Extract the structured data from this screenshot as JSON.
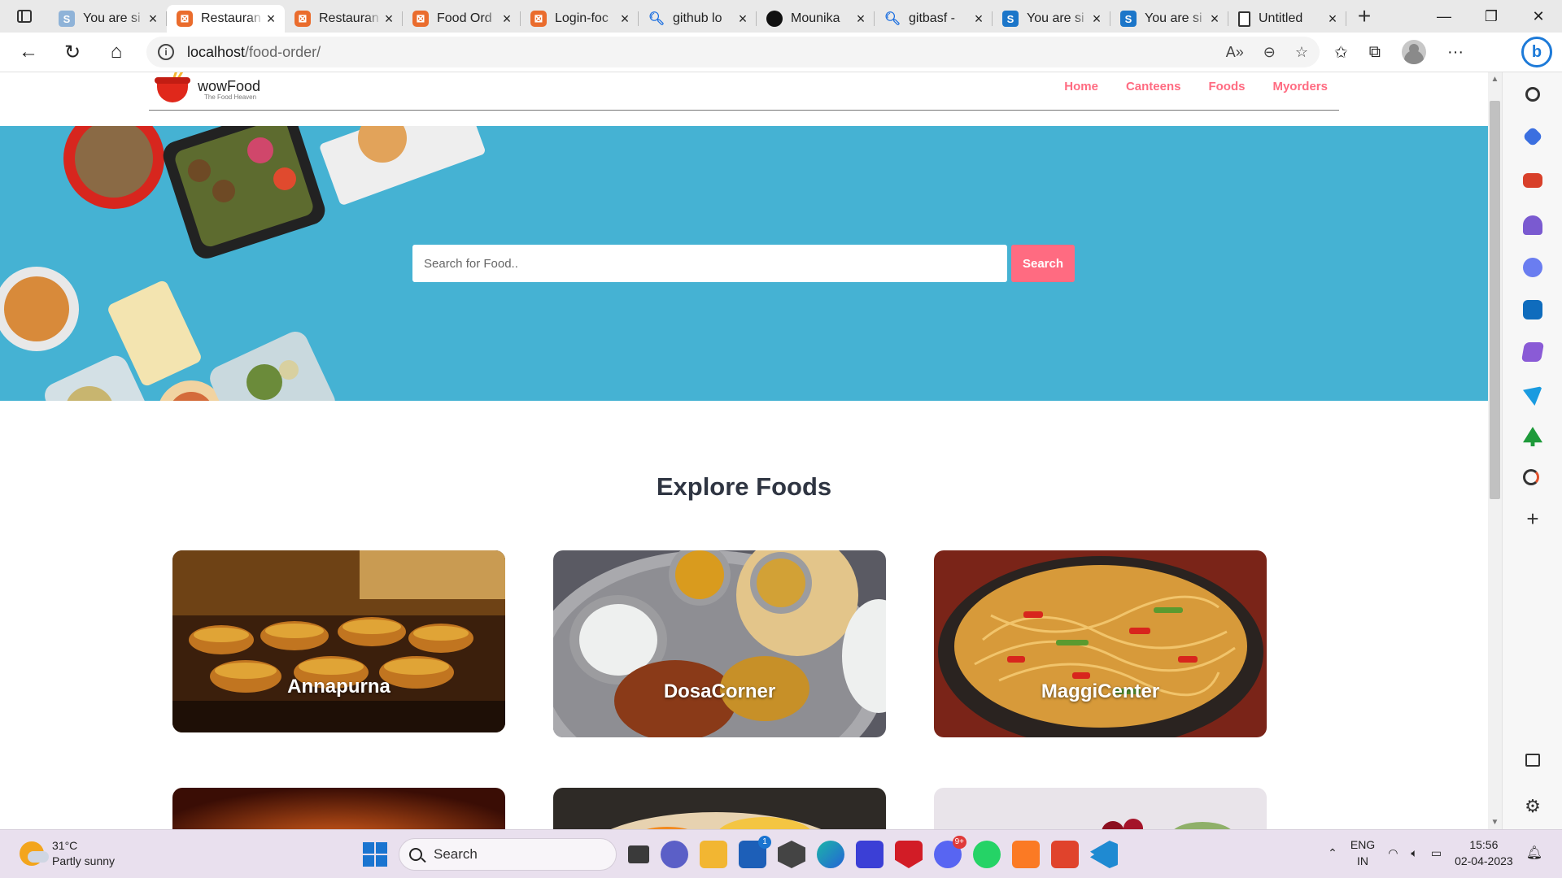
{
  "browser": {
    "tabs": [
      {
        "title": "You are si",
        "favicon": "s-icon",
        "active": false
      },
      {
        "title": "Restauran",
        "favicon": "xampp-icon",
        "active": true
      },
      {
        "title": "Restauran",
        "favicon": "xampp-icon",
        "active": false
      },
      {
        "title": "Food Ord",
        "favicon": "xampp-icon",
        "active": false
      },
      {
        "title": "Login-foc",
        "favicon": "xampp-icon",
        "active": false
      },
      {
        "title": "github lo",
        "favicon": "search-icon",
        "active": false
      },
      {
        "title": "Mounika",
        "favicon": "github-icon",
        "active": false
      },
      {
        "title": "gitbasf -",
        "favicon": "search-icon",
        "active": false
      },
      {
        "title": "You are si",
        "favicon": "s-icon",
        "active": false
      },
      {
        "title": "You are si",
        "favicon": "s-icon",
        "active": false
      },
      {
        "title": "Untitled",
        "favicon": "page-icon",
        "active": false
      }
    ],
    "address": {
      "host": "localhost",
      "path": "/food-order/"
    }
  },
  "site": {
    "brand": {
      "name": "wowFood",
      "tagline": "The Food Heaven"
    },
    "nav": [
      "Home",
      "Canteens",
      "Foods",
      "Myorders"
    ],
    "search": {
      "placeholder": "Search for Food..",
      "value": "",
      "button": "Search"
    },
    "section_title": "Explore Foods",
    "cards": [
      {
        "label": "Annapurna"
      },
      {
        "label": "DosaCorner"
      },
      {
        "label": "MaggiCenter"
      },
      {
        "label": ""
      },
      {
        "label": ""
      },
      {
        "label": ""
      }
    ],
    "colors": {
      "accent": "#ff6b81",
      "hero_bg": "#45b2d3",
      "heading": "#2f3542"
    }
  },
  "taskbar": {
    "weather": {
      "temp": "31°C",
      "condition": "Partly sunny"
    },
    "search_placeholder": "Search",
    "lang": {
      "top": "ENG",
      "bottom": "IN"
    },
    "clock": {
      "time": "15:56",
      "date": "02-04-2023"
    },
    "badges": {
      "store": "1",
      "discord": "9+"
    }
  }
}
